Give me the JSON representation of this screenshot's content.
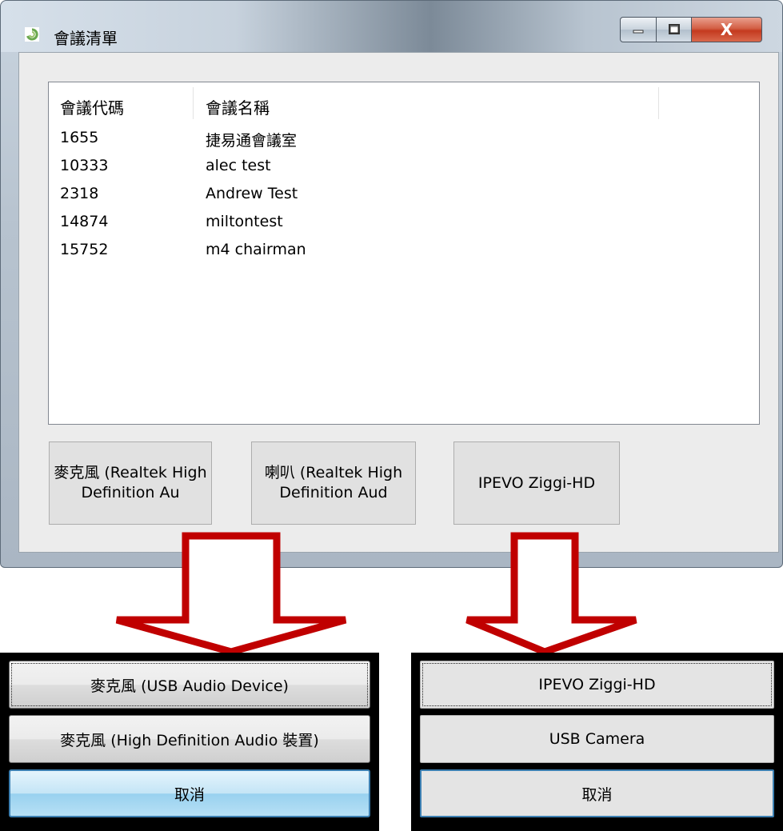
{
  "window": {
    "title": "會議清單",
    "close_label": "X"
  },
  "table": {
    "headers": [
      "會議代碼",
      "會議名稱"
    ],
    "rows": [
      {
        "code": "1655",
        "name": "捷易通會議室"
      },
      {
        "code": "10333",
        "name": "alec test"
      },
      {
        "code": "2318",
        "name": "Andrew Test"
      },
      {
        "code": "14874",
        "name": "miltontest"
      },
      {
        "code": "15752",
        "name": "m4 chairman"
      }
    ]
  },
  "device_buttons": {
    "mic": "麥克風 (Realtek High Definition Au",
    "speaker": "喇叭 (Realtek High Definition Aud",
    "camera": "IPEVO Ziggi-HD"
  },
  "mic_popup": {
    "option1": "麥克風 (USB Audio Device)",
    "option2": "麥克風 (High Definition Audio 裝置)",
    "cancel": "取消"
  },
  "camera_popup": {
    "option1": "IPEVO Ziggi-HD",
    "option2": "USB Camera",
    "cancel": "取消"
  },
  "colors": {
    "arrow": "#c00000",
    "close_button": "#c9452a",
    "cancel_highlight": "#3c7fb1"
  }
}
